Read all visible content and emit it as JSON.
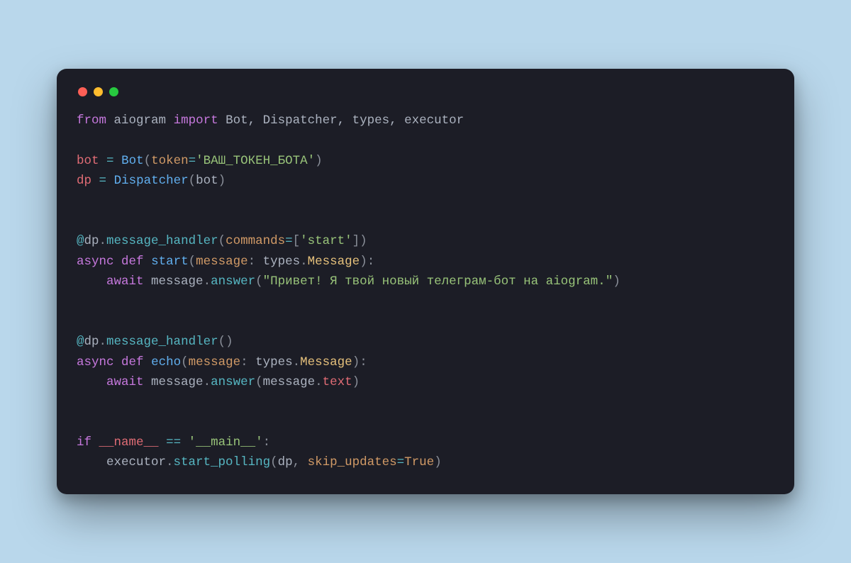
{
  "window": {
    "traffic_lights": [
      "red",
      "yellow",
      "green"
    ]
  },
  "code": {
    "l1": {
      "from": "from",
      "mod": "aiogram",
      "import": "import",
      "items": "Bot, Dispatcher, types, executor"
    },
    "l3": {
      "lhs": "bot",
      "eq": "=",
      "cls": "Bot",
      "lp": "(",
      "kw": "token",
      "eq2": "=",
      "str": "'ВАШ_ТОКЕН_БОТА'",
      "rp": ")"
    },
    "l4": {
      "lhs": "dp",
      "eq": "=",
      "cls": "Dispatcher",
      "lp": "(",
      "arg": "bot",
      "rp": ")"
    },
    "l7": {
      "at": "@",
      "obj": "dp",
      "dot": ".",
      "m": "message_handler",
      "lp": "(",
      "kw": "commands",
      "eq": "=",
      "lb": "[",
      "str": "'start'",
      "rb": "]",
      "rp": ")"
    },
    "l8": {
      "async": "async",
      "def": "def",
      "fn": "start",
      "lp": "(",
      "p": "message",
      "colon": ":",
      "ns": "types",
      "dot": ".",
      "typ": "Message",
      "rp": ")",
      "c2": ":"
    },
    "l9": {
      "indent": "    ",
      "await": "await",
      "obj": "message",
      "dot": ".",
      "m": "answer",
      "lp": "(",
      "str": "\"Привет! Я твой новый телеграм-бот на aiogram.\"",
      "rp": ")"
    },
    "l12": {
      "at": "@",
      "obj": "dp",
      "dot": ".",
      "m": "message_handler",
      "lp": "(",
      "rp": ")"
    },
    "l13": {
      "async": "async",
      "def": "def",
      "fn": "echo",
      "lp": "(",
      "p": "message",
      "colon": ":",
      "ns": "types",
      "dot": ".",
      "typ": "Message",
      "rp": ")",
      "c2": ":"
    },
    "l14": {
      "indent": "    ",
      "await": "await",
      "obj": "message",
      "dot": ".",
      "m": "answer",
      "lp": "(",
      "a1": "message",
      "dot2": ".",
      "a2": "text",
      "rp": ")"
    },
    "l17": {
      "if": "if",
      "name": "__name__",
      "eq": "==",
      "str": "'__main__'",
      "colon": ":"
    },
    "l18": {
      "indent": "    ",
      "obj": "executor",
      "dot": ".",
      "m": "start_polling",
      "lp": "(",
      "a1": "dp",
      "comma": ", ",
      "kw": "skip_updates",
      "eq": "=",
      "val": "True",
      "rp": ")"
    }
  }
}
